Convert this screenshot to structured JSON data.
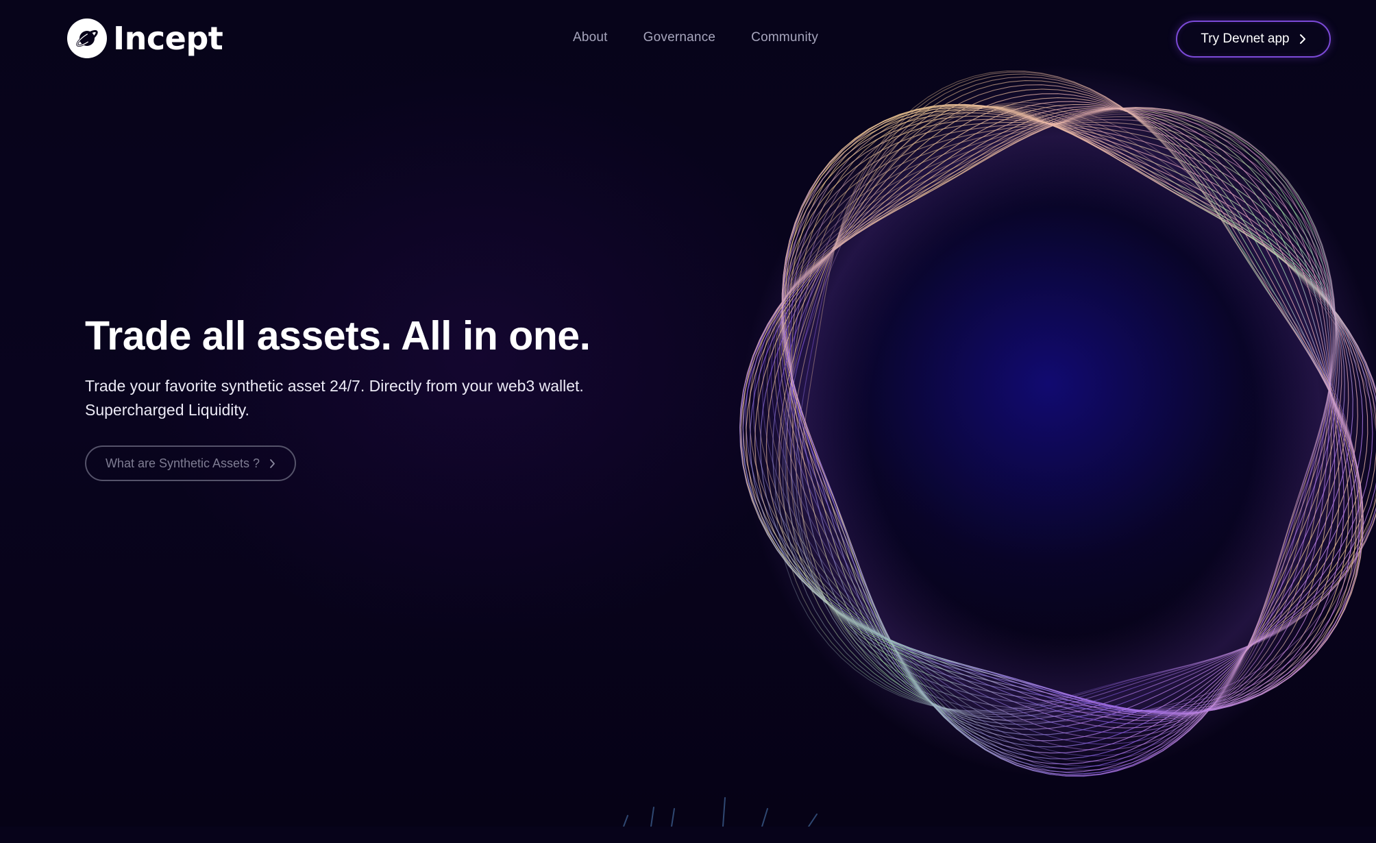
{
  "brand": {
    "name": "Incept",
    "logo_icon": "planet-icon"
  },
  "nav": {
    "links": [
      {
        "label": "About"
      },
      {
        "label": "Governance"
      },
      {
        "label": "Community"
      }
    ],
    "cta": {
      "label": "Try Devnet app",
      "icon": "chevron-right-icon"
    }
  },
  "hero": {
    "headline": "Trade all assets. All in one.",
    "subtext_line1": "Trade your favorite synthetic asset 24/7. Directly from your web3 wallet.",
    "subtext_line2": "Supercharged Liquidity.",
    "secondary_button": {
      "label": "What are Synthetic Assets ?",
      "icon": "chevron-right-icon"
    }
  },
  "colors": {
    "background": "#07031a",
    "cta_border": "#7c4ad8",
    "nav_link": "#a7a6bd",
    "ring_gold": "#f2c98a",
    "ring_violet": "#a66cf0",
    "ring_green": "#9fe0a8"
  }
}
